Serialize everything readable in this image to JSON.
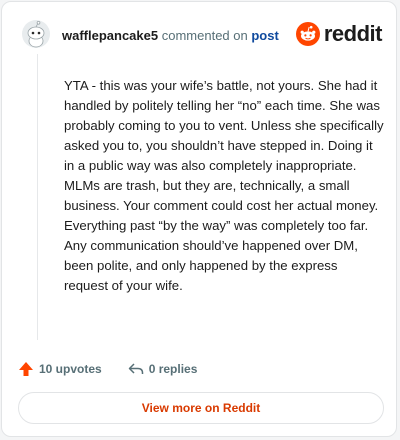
{
  "comment": {
    "username": "wafflepancake5",
    "action_text": "commented on",
    "post_link": "post",
    "body": "YTA - this was your wife’s battle, not yours. She had it handled by politely telling her “no” each time. She was probably coming to you to vent. Unless she specifically asked you to, you shouldn’t have stepped in. Doing it in a public way was also completely inappropriate. MLMs are trash, but they are, technically, a small business. Your comment could cost her actual money. Everything past “by the way” was completely too far. Any communication should’ve happened over DM, been polite, and only happened by the express request of your wife.",
    "upvotes": "10 upvotes",
    "replies": "0 replies"
  },
  "brand": {
    "name": "reddit",
    "icon": "reddit-logo-icon",
    "color": "#ff4500"
  },
  "footer": {
    "view_more": "View more on Reddit"
  },
  "colors": {
    "accent": "#d93a00",
    "upvote": "#ff4500",
    "link": "#0f4a9e"
  }
}
